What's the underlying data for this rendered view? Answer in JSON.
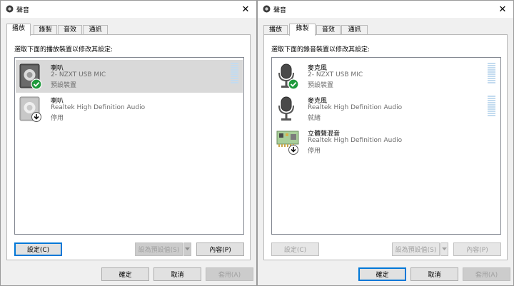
{
  "left": {
    "title": "聲音",
    "tabs": [
      "播放",
      "錄製",
      "音效",
      "通訊"
    ],
    "selected_tab": 0,
    "instruction": "選取下面的播放裝置以修改其設定:",
    "devices": [
      {
        "name": "喇叭",
        "desc": "2- NZXT USB MIC",
        "status": "預設裝置",
        "icon": "speaker-icon",
        "badge": "default-check-icon",
        "selected": true,
        "meter": true
      },
      {
        "name": "喇叭",
        "desc": "Realtek High Definition Audio",
        "status": "停用",
        "icon": "speaker-icon",
        "badge": "disabled-arrow-icon",
        "selected": false,
        "meter": false
      }
    ],
    "buttons": {
      "configure": "設定(C)",
      "set_default": "設為預設值(S)",
      "properties": "內容(P)"
    },
    "footer": {
      "ok": "確定",
      "cancel": "取消",
      "apply": "套用(A)"
    }
  },
  "right": {
    "title": "聲音",
    "tabs": [
      "播放",
      "錄製",
      "音效",
      "通訊"
    ],
    "selected_tab": 1,
    "instruction": "選取下面的錄音裝置以修改其設定:",
    "devices": [
      {
        "name": "麥克風",
        "desc": "2- NZXT USB MIC",
        "status": "預設裝置",
        "icon": "microphone-icon",
        "badge": "default-check-icon",
        "selected": false,
        "meter": true
      },
      {
        "name": "麥克風",
        "desc": "Realtek High Definition Audio",
        "status": "就緒",
        "icon": "microphone-icon",
        "badge": "none",
        "selected": false,
        "meter": true
      },
      {
        "name": "立體聲混音",
        "desc": "Realtek High Definition Audio",
        "status": "停用",
        "icon": "sound-card-icon",
        "badge": "disabled-arrow-icon",
        "selected": false,
        "meter": false
      }
    ],
    "buttons": {
      "configure": "設定(C)",
      "set_default": "設為預設值(S)",
      "properties": "內容(P)"
    },
    "footer": {
      "ok": "確定",
      "cancel": "取消",
      "apply": "套用(A)"
    }
  },
  "colors": {
    "check_green": "#1e9a3c",
    "meter_blue": "#c3dbef",
    "focus_blue": "#0078d7",
    "selection": "#d9d9d9"
  }
}
